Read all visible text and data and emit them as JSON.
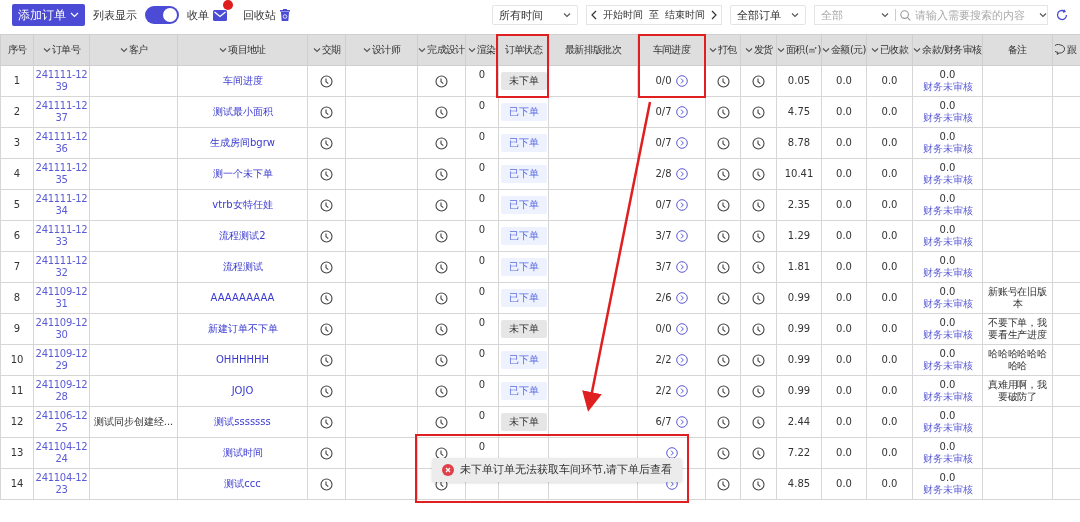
{
  "toolbar": {
    "add_button": "添加订单",
    "view_label": "列表显示",
    "list_view_on": true,
    "inbox_label": "收单",
    "inbox_alert": true,
    "recycle_label": "回收站",
    "time_select": "所有时间",
    "start_placeholder": "开始时间",
    "range_sep": "至",
    "end_placeholder": "结束时间",
    "order_select": "全部订单",
    "field_select": "全部",
    "search_placeholder": "请输入需要搜索的内容"
  },
  "columns": [
    {
      "label": "序号",
      "sortable": false
    },
    {
      "label": "订单号",
      "sortable": true
    },
    {
      "label": "客户",
      "sortable": true
    },
    {
      "label": "项目地址",
      "sortable": true
    },
    {
      "label": "交期",
      "sortable": true
    },
    {
      "label": "设计师",
      "sortable": true
    },
    {
      "label": "完成设计",
      "sortable": true
    },
    {
      "label": "渲染",
      "sortable": true
    },
    {
      "label": "订单状态",
      "sortable": false
    },
    {
      "label": "最新排版批次",
      "sortable": false
    },
    {
      "label": "车间进度",
      "sortable": false
    },
    {
      "label": "打包",
      "sortable": true
    },
    {
      "label": "发货",
      "sortable": true
    },
    {
      "label": "面积(㎡)",
      "sortable": true
    },
    {
      "label": "金额(元)",
      "sortable": true
    },
    {
      "label": "已收款",
      "sortable": true
    },
    {
      "label": "余款/财务审核",
      "sortable": true
    },
    {
      "label": "备注",
      "sortable": false
    },
    {
      "label": "跟",
      "sortable": false,
      "chat_icon": true
    }
  ],
  "rows": [
    {
      "index": "1",
      "order_no": "241111-1239",
      "project": "车间进度",
      "rendering": "0",
      "status": {
        "label": "未下单",
        "placed": false
      },
      "progress": "0/0",
      "area": "0.05",
      "amount": "0.0",
      "received": "0.0",
      "balance": "0.0",
      "audit": "财务未审核"
    },
    {
      "index": "2",
      "order_no": "241111-1237",
      "project": "测试最小面积",
      "rendering": "0",
      "status": {
        "label": "已下单",
        "placed": true
      },
      "progress": "0/7",
      "area": "4.75",
      "amount": "0.0",
      "received": "0.0",
      "balance": "0.0",
      "audit": "财务未审核"
    },
    {
      "index": "3",
      "order_no": "241111-1236",
      "project": "生成房间bgrw",
      "rendering": "0",
      "status": {
        "label": "已下单",
        "placed": true
      },
      "progress": "0/7",
      "area": "8.78",
      "amount": "0.0",
      "received": "0.0",
      "balance": "0.0",
      "audit": "财务未审核"
    },
    {
      "index": "4",
      "order_no": "241111-1235",
      "project": "测一个未下单",
      "rendering": "0",
      "status": {
        "label": "已下单",
        "placed": true
      },
      "progress": "2/8",
      "area": "10.41",
      "amount": "0.0",
      "received": "0.0",
      "balance": "0.0",
      "audit": "财务未审核"
    },
    {
      "index": "5",
      "order_no": "241111-1234",
      "project": "vtrb女特任娃",
      "rendering": "0",
      "status": {
        "label": "已下单",
        "placed": true
      },
      "progress": "0/7",
      "area": "2.35",
      "amount": "0.0",
      "received": "0.0",
      "balance": "0.0",
      "audit": "财务未审核"
    },
    {
      "index": "6",
      "order_no": "241111-1233",
      "project": "流程测试2",
      "rendering": "0",
      "status": {
        "label": "已下单",
        "placed": true
      },
      "progress": "3/7",
      "area": "1.29",
      "amount": "0.0",
      "received": "0.0",
      "balance": "0.0",
      "audit": "财务未审核"
    },
    {
      "index": "7",
      "order_no": "241111-1232",
      "project": "流程测试",
      "rendering": "0",
      "status": {
        "label": "已下单",
        "placed": true
      },
      "progress": "3/7",
      "area": "1.81",
      "amount": "0.0",
      "received": "0.0",
      "balance": "0.0",
      "audit": "财务未审核"
    },
    {
      "index": "8",
      "order_no": "241109-1231",
      "project": "AAAAAAAAA",
      "rendering": "0",
      "status": {
        "label": "已下单",
        "placed": true
      },
      "progress": "2/6",
      "area": "0.99",
      "amount": "0.0",
      "received": "0.0",
      "balance": "0.0",
      "audit": "财务未审核",
      "remark": "新账号在旧版本"
    },
    {
      "index": "9",
      "order_no": "241109-1230",
      "project": "新建订单不下单",
      "rendering": "0",
      "status": {
        "label": "未下单",
        "placed": false
      },
      "progress": "0/0",
      "area": "0.99",
      "amount": "0.0",
      "received": "0.0",
      "balance": "0.0",
      "audit": "财务未审核",
      "remark": "不要下单，我要看生产进度"
    },
    {
      "index": "10",
      "order_no": "241109-1229",
      "project": "OHHHHHH",
      "rendering": "0",
      "status": {
        "label": "已下单",
        "placed": true
      },
      "progress": "2/2",
      "area": "0.99",
      "amount": "0.0",
      "received": "0.0",
      "balance": "0.0",
      "audit": "财务未审核",
      "remark": "哈哈哈哈哈哈哈哈"
    },
    {
      "index": "11",
      "order_no": "241109-1228",
      "project": "JOJO",
      "rendering": "0",
      "status": {
        "label": "已下单",
        "placed": true
      },
      "progress": "2/2",
      "area": "0.99",
      "amount": "0.0",
      "received": "0.0",
      "balance": "0.0",
      "audit": "财务未审核",
      "remark": "真难用啊，我要破防了"
    },
    {
      "index": "12",
      "order_no": "241106-1225",
      "customer": "测试同步创建经...",
      "project": "测试sssssss",
      "rendering": "0",
      "status": {
        "label": "未下单",
        "placed": false
      },
      "progress": "6/7",
      "area": "2.44",
      "amount": "0.0",
      "received": "0.0",
      "balance": "0.0",
      "audit": "财务未审核"
    },
    {
      "index": "13",
      "order_no": "241104-1224",
      "project": "测试时间",
      "rendering": "0",
      "area": "7.22",
      "amount": "0.0",
      "received": "0.0",
      "balance": "0.0",
      "audit": "财务未审核"
    },
    {
      "index": "14",
      "order_no": "241104-1223",
      "project": "测试ccc",
      "area": "4.85",
      "amount": "0.0",
      "received": "0.0",
      "balance": "0.0",
      "audit": "财务未审核"
    }
  ],
  "toast": {
    "kind": "error",
    "message": "未下单订单无法获取车间环节,请下单后查看"
  }
}
